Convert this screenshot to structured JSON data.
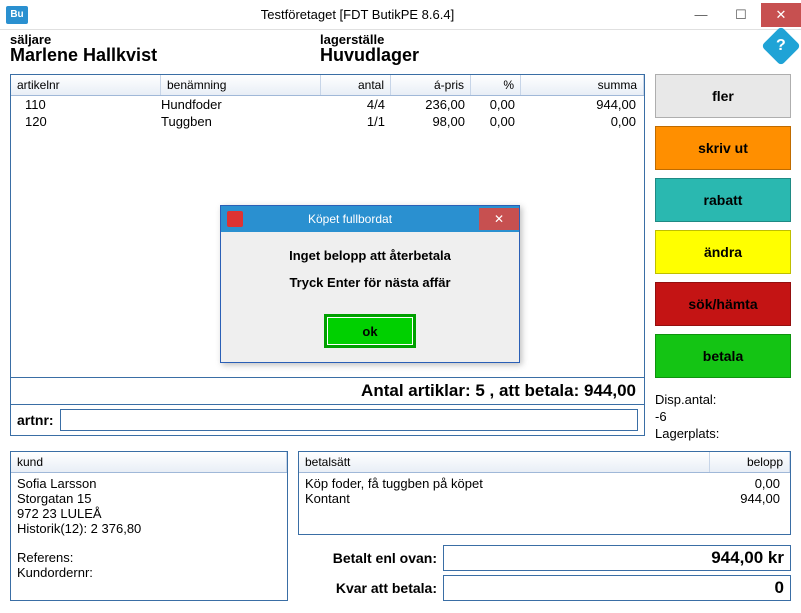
{
  "window": {
    "app_icon": "Bu",
    "title": "Testföretaget [FDT ButikPE 8.6.4]"
  },
  "header": {
    "seller_label": "säljare",
    "seller_name": "Marlene Hallkvist",
    "stock_label": "lagerställe",
    "stock_name": "Huvudlager"
  },
  "grid": {
    "headers": {
      "artikelnr": "artikelnr",
      "benamning": "benämning",
      "antal": "antal",
      "apris": "á-pris",
      "pct": "%",
      "summa": "summa"
    },
    "rows": [
      {
        "artikelnr": "110",
        "benamning": "Hundfoder",
        "antal": "4/4",
        "apris": "236,00",
        "pct": "0,00",
        "summa": "944,00"
      },
      {
        "artikelnr": "120",
        "benamning": "Tuggben",
        "antal": "1/1",
        "apris": "98,00",
        "pct": "0,00",
        "summa": "0,00"
      }
    ],
    "footer": "Antal artiklar: 5 , att betala: 944,00"
  },
  "artnr": {
    "label": "artnr:",
    "value": ""
  },
  "side_buttons": {
    "fler": "fler",
    "skriv_ut": "skriv ut",
    "rabatt": "rabatt",
    "andra": "ändra",
    "sok_hamta": "sök/hämta",
    "betala": "betala"
  },
  "info": {
    "disp_label": "Disp.antal:",
    "disp_value": "-6",
    "lagerplats_label": "Lagerplats:"
  },
  "kund": {
    "header": "kund",
    "name": "Sofia Larsson",
    "addr1": "Storgatan 15",
    "addr2": "972 23 LULEÅ",
    "historik": "Historik(12): 2 376,80",
    "referens_label": "Referens:",
    "kundorder_label": "Kundordernr:"
  },
  "payment": {
    "headers": {
      "betalsatt": "betalsätt",
      "belopp": "belopp"
    },
    "rows": [
      {
        "name": "Köp foder, få tuggben på köpet",
        "amount": "0,00"
      },
      {
        "name": "Kontant",
        "amount": "944,00"
      }
    ]
  },
  "sums": {
    "betalt_label": "Betalt enl ovan:",
    "betalt_value": "944,00 kr",
    "kvar_label": "Kvar att betala:",
    "kvar_value": "0"
  },
  "modal": {
    "title": "Köpet fullbordat",
    "line1": "Inget belopp att återbetala",
    "line2": "Tryck Enter för nästa affär",
    "ok": "ok"
  }
}
